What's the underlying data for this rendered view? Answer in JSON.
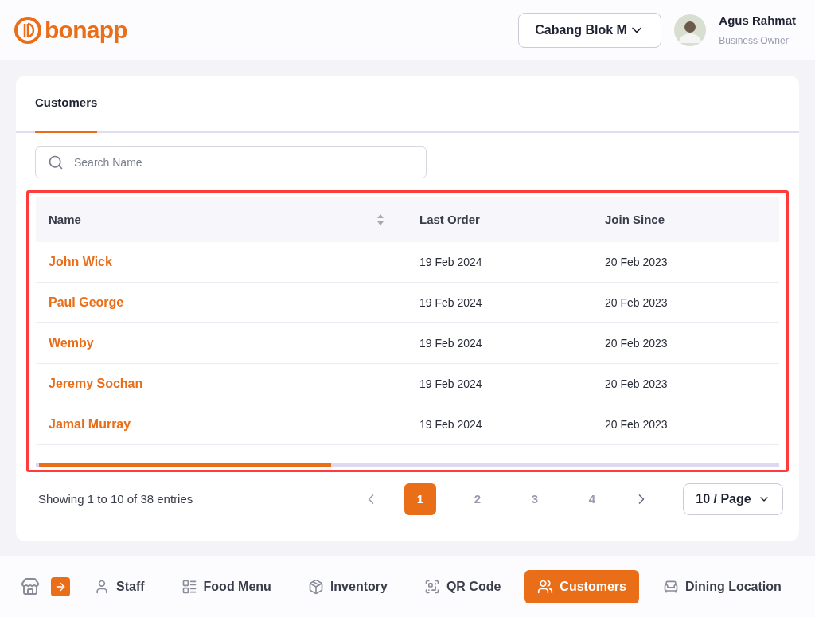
{
  "header": {
    "brand": "bonapp",
    "branch": "Cabang Blok M",
    "user": {
      "name": "Agus Rahmat",
      "role": "Business Owner"
    }
  },
  "tabs": [
    {
      "label": "Customers",
      "selected": true
    }
  ],
  "search": {
    "placeholder": "Search Name"
  },
  "table": {
    "columns": [
      {
        "label": "Name",
        "sortable": true
      },
      {
        "label": "Last Order",
        "sortable": false
      },
      {
        "label": "Join Since",
        "sortable": false
      }
    ],
    "rows": [
      {
        "name": "John Wick",
        "last_order": "19 Feb 2024",
        "join_since": "20 Feb 2023"
      },
      {
        "name": "Paul George",
        "last_order": "19 Feb 2024",
        "join_since": "20 Feb 2023"
      },
      {
        "name": "Wemby",
        "last_order": "19 Feb 2024",
        "join_since": "20 Feb 2023"
      },
      {
        "name": "Jeremy Sochan",
        "last_order": "19 Feb 2024",
        "join_since": "20 Feb 2023"
      },
      {
        "name": "Jamal Murray",
        "last_order": "19 Feb 2024",
        "join_since": "20 Feb 2023"
      }
    ]
  },
  "pagination": {
    "summary": "Showing 1 to 10 of 38 entries",
    "pages": [
      {
        "label": "1",
        "selected": true
      },
      {
        "label": "2",
        "selected": false
      },
      {
        "label": "3",
        "selected": false
      },
      {
        "label": "4",
        "selected": false
      }
    ],
    "page_size": "10 / Page"
  },
  "bottom_nav": [
    {
      "kind": "store"
    },
    {
      "kind": "expand"
    },
    {
      "label": "Staff",
      "kind": "staff",
      "selected": false
    },
    {
      "label": "Food Menu",
      "kind": "menu",
      "selected": false
    },
    {
      "label": "Inventory",
      "kind": "inventory",
      "selected": false
    },
    {
      "label": "QR Code",
      "kind": "qr",
      "selected": false
    },
    {
      "label": "Customers",
      "kind": "customers",
      "selected": true
    },
    {
      "label": "Dining Location",
      "kind": "dining",
      "selected": false
    }
  ]
}
